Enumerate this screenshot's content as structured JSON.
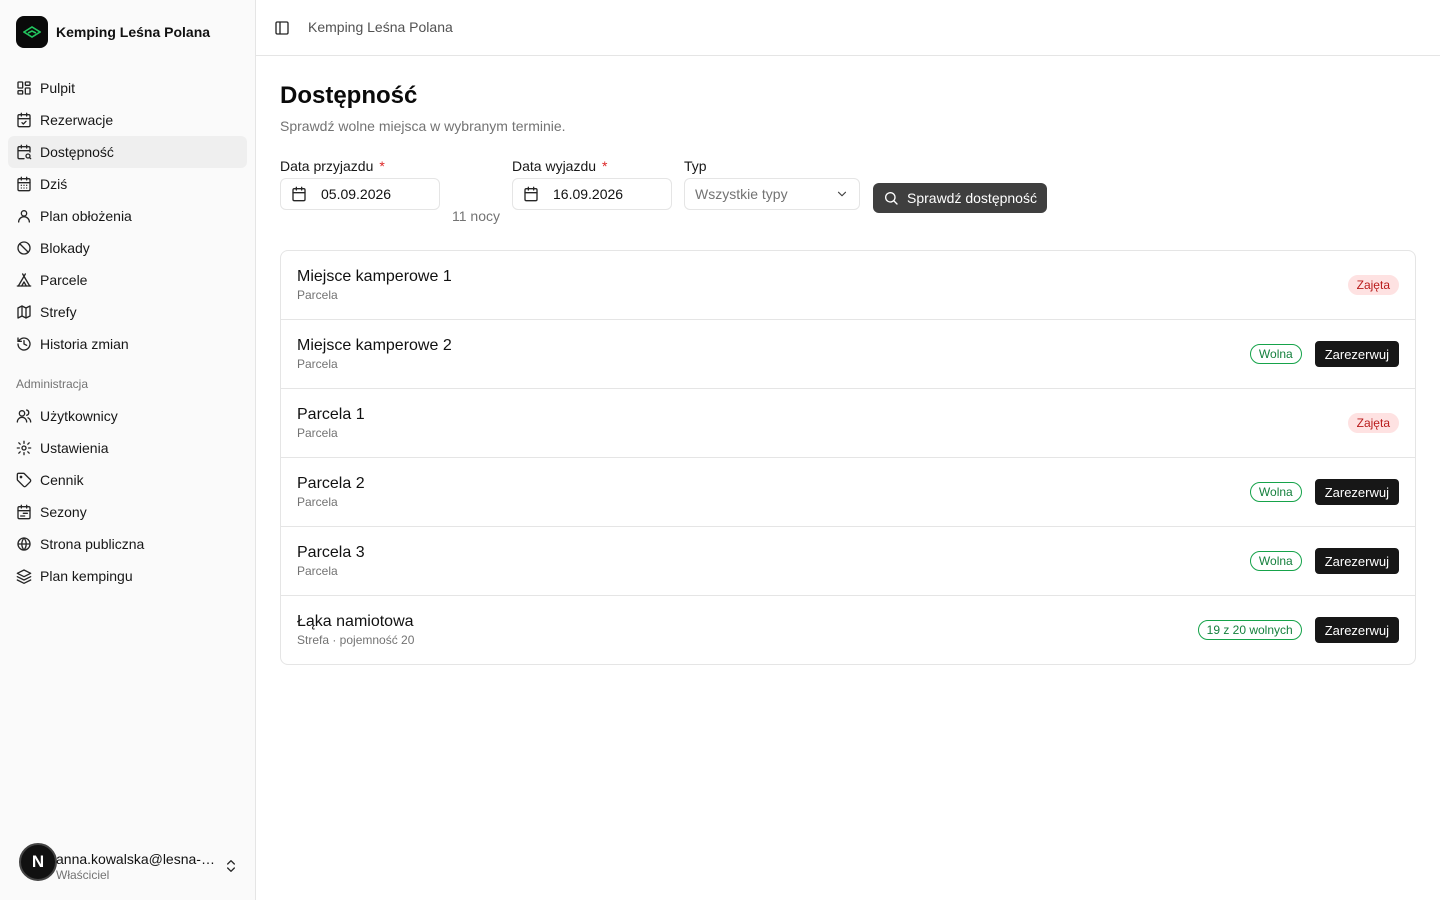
{
  "brand": {
    "name": "Kemping Leśna Polana",
    "logo_icon": "tent-logo-icon",
    "accent": "#22c55e"
  },
  "sidebar": {
    "items": [
      {
        "label": "Pulpit",
        "icon": "dashboard-icon"
      },
      {
        "label": "Rezerwacje",
        "icon": "calendar-check-icon"
      },
      {
        "label": "Dostępność",
        "icon": "calendar-search-icon",
        "active": true
      },
      {
        "label": "Dziś",
        "icon": "calendar-days-icon"
      },
      {
        "label": "Plan obłożenia",
        "icon": "user-icon"
      },
      {
        "label": "Blokady",
        "icon": "ban-icon"
      },
      {
        "label": "Parcele",
        "icon": "tent-icon"
      },
      {
        "label": "Strefy",
        "icon": "map-icon"
      },
      {
        "label": "Historia zmian",
        "icon": "history-icon"
      }
    ],
    "admin_section": "Administracja",
    "admin_items": [
      {
        "label": "Użytkownicy",
        "icon": "users-icon"
      },
      {
        "label": "Ustawienia",
        "icon": "gear-icon"
      },
      {
        "label": "Cennik",
        "icon": "tag-icon"
      },
      {
        "label": "Sezony",
        "icon": "calendar-range-icon"
      },
      {
        "label": "Strona publiczna",
        "icon": "globe-icon"
      },
      {
        "label": "Plan kempingu",
        "icon": "map-layers-icon"
      }
    ],
    "user": {
      "initial": "N",
      "email": "anna.kowalska@lesna-polana.pl",
      "role": "Właściciel"
    }
  },
  "header": {
    "breadcrumb": "Kemping Leśna Polana"
  },
  "page": {
    "title": "Dostępność",
    "subtitle": "Sprawdź wolne miejsca w wybranym terminie.",
    "arrival_label": "Data przyjazdu",
    "arrival_value": "05.09.2026",
    "departure_label": "Data wyjazdu",
    "departure_value": "16.09.2026",
    "required_mark": "*",
    "nights": "11 nocy",
    "type_label": "Typ",
    "type_placeholder": "Wszystkie typy",
    "check_button": "Sprawdź dostępność"
  },
  "results": [
    {
      "name": "Miejsce kamperowe 1",
      "sub": "Parcela",
      "status": "Zajęta",
      "status_kind": "taken",
      "bookable": false
    },
    {
      "name": "Miejsce kamperowe 2",
      "sub": "Parcela",
      "status": "Wolna",
      "status_kind": "free",
      "bookable": true
    },
    {
      "name": "Parcela 1",
      "sub": "Parcela",
      "status": "Zajęta",
      "status_kind": "taken",
      "bookable": false
    },
    {
      "name": "Parcela 2",
      "sub": "Parcela",
      "status": "Wolna",
      "status_kind": "free",
      "bookable": true
    },
    {
      "name": "Parcela 3",
      "sub": "Parcela",
      "status": "Wolna",
      "status_kind": "free",
      "bookable": true
    },
    {
      "name": "Łąka namiotowa",
      "sub": "Strefa · pojemność 20",
      "status": "19 z 20 wolnych",
      "status_kind": "free",
      "bookable": true
    }
  ],
  "book_label": "Zarezerwuj"
}
